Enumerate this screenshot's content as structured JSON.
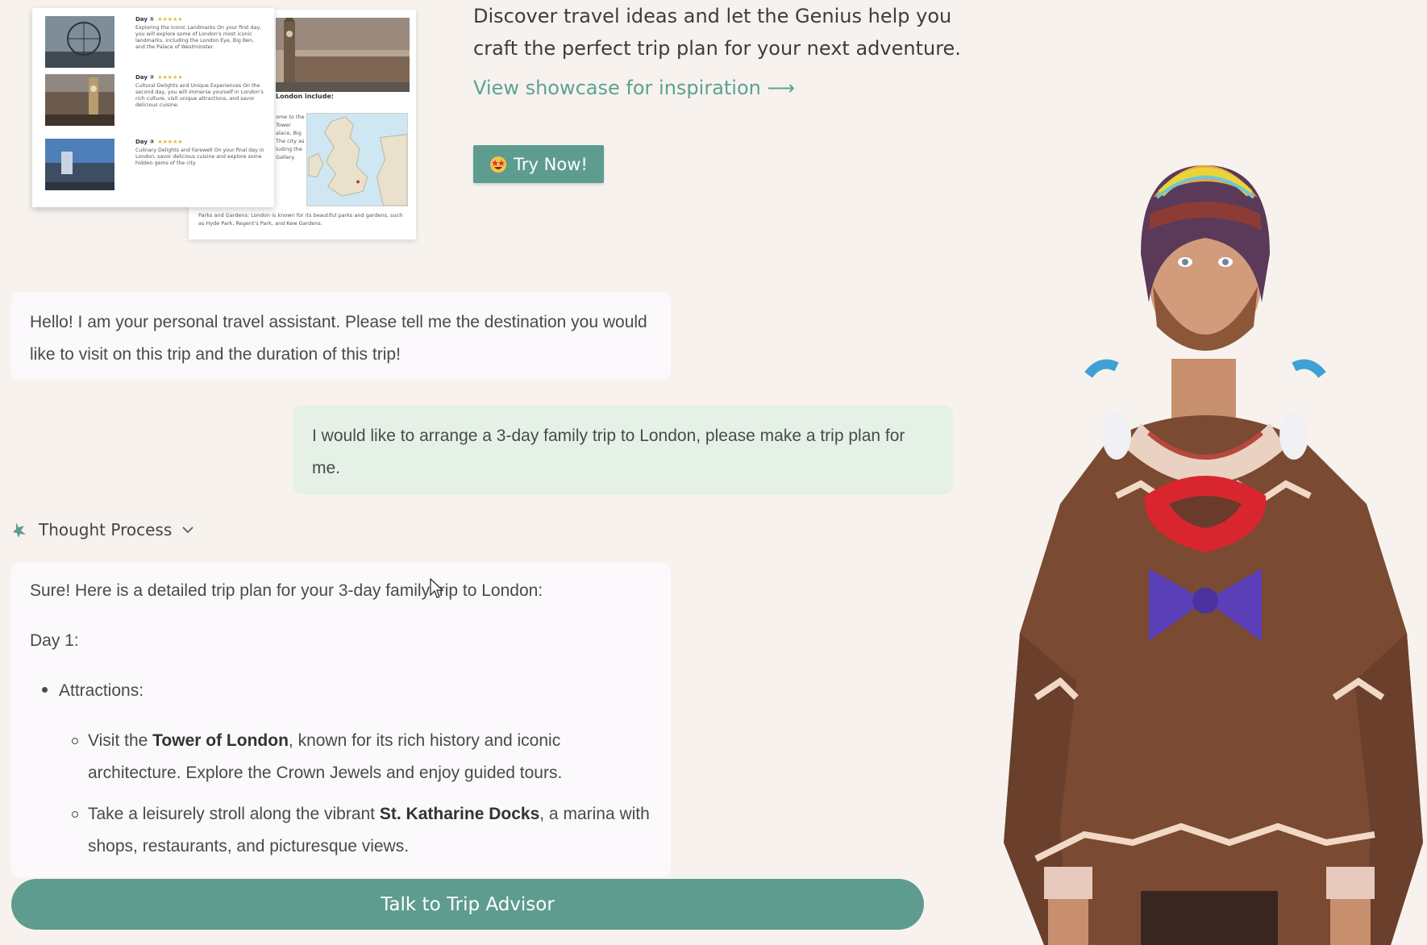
{
  "showcase_preview": {
    "days": [
      {
        "title": "Day ①",
        "stars": "★★★★★",
        "text": "Exploring the Iconic Landmarks On your first day, you will explore some of London's most iconic landmarks, including the London Eye, Big Ben, and the Palace of Westminster."
      },
      {
        "title": "Day ②",
        "stars": "★★★★★",
        "text": "Cultural Delights and Unique Experiences On the second day, you will immerse yourself in London's rich culture, visit unique attractions, and savor delicious cuisine."
      },
      {
        "title": "Day ③",
        "stars": "★★★★★",
        "text": "Culinary Delights and Farewell On your final day in London, savor delicious cuisine and explore some hidden gems of the city"
      }
    ],
    "back_heading": "London include:",
    "back_snippet": "ome to the Tower alace, Big The city as luding the Gallery.",
    "back_footer": "Parks and Gardens: London is known for its beautiful parks and gardens, such as Hyde Park, Regent's Park, and Kew Gardens."
  },
  "intro": {
    "text": "Discover travel ideas and let the Genius help you craft the perfect trip plan for your next adventure.",
    "showcase_link": "View showcase for inspiration ⟶",
    "try_button": "Try Now!"
  },
  "chat": {
    "assistant_greeting": "Hello! I am your personal travel assistant. Please tell me the destination you would like to visit on this trip and the duration of this trip!",
    "user_message": "I would like to arrange a 3-day family trip to London, please make a trip plan for me.",
    "thought_process_label": "Thought Process",
    "answer": {
      "intro": "Sure! Here is a detailed trip plan for your 3-day family trip to London:",
      "day_label": "Day 1:",
      "section": "Attractions:",
      "items": [
        {
          "pre": "Visit the ",
          "bold": "Tower of London",
          "post": ", known for its rich history and iconic architecture. Explore the Crown Jewels and enjoy guided tours."
        },
        {
          "pre": "Take a leisurely stroll along the vibrant ",
          "bold": "St. Katharine Docks",
          "post": ", a marina with shops, restaurants, and picturesque views."
        }
      ]
    }
  },
  "talk_button": "Talk to Trip Advisor",
  "colors": {
    "accent": "#5e9c8f",
    "link": "#5aa394",
    "user_bubble": "#e5f1e6",
    "background": "#f7f2ee"
  }
}
